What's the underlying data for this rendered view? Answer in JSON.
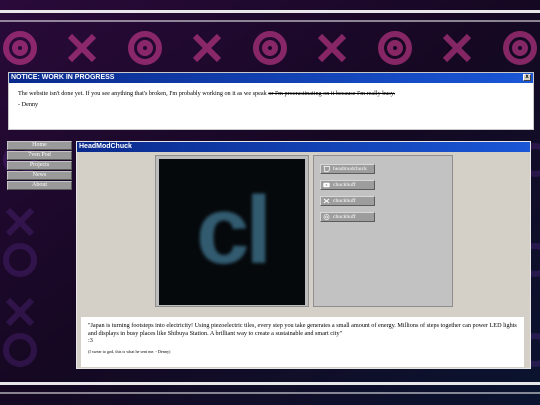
{
  "notice": {
    "title": "NOTICE: WORK IN PROGRESS",
    "close_label": "x",
    "line1": "The website isn't done yet. If you see anything that's broken, I'm probably working on it as we speak",
    "line1_strike": "or I'm procrastinating on it because I'm really busy.",
    "signature": "- Denny"
  },
  "nav": {
    "items": [
      {
        "label": "Home"
      },
      {
        "label": "7ven Pod"
      },
      {
        "label": "Projects"
      },
      {
        "label": "News"
      },
      {
        "label": "About"
      }
    ]
  },
  "profile": {
    "title": "HeadModChuck",
    "logo_text": "cl",
    "links": [
      {
        "label": "headmodchuck",
        "icon": "twitch-icon"
      },
      {
        "label": "chuckhuff",
        "icon": "youtube-icon"
      },
      {
        "label": "chuckhuff",
        "icon": "twitter-icon"
      },
      {
        "label": "chuckhuff",
        "icon": "instagram-icon"
      }
    ]
  },
  "post": {
    "text": "\"Japan is turning footsteps into electricity! Using piezoelectric tiles, every step you take generates a small amount of energy. Millions of steps together can power LED lights and displays in busy places like Shibuya Station. A brilliant way to create a sustainable and smart city\"",
    "emote": ":3",
    "footnote": "(I swear to god, this is what he sent me. - Denny)"
  },
  "colors": {
    "titlebar_start": "#0a2a8c",
    "titlebar_end": "#1a56d6",
    "background_accent": "#e0409a",
    "window_gray": "#d4d0c8"
  }
}
